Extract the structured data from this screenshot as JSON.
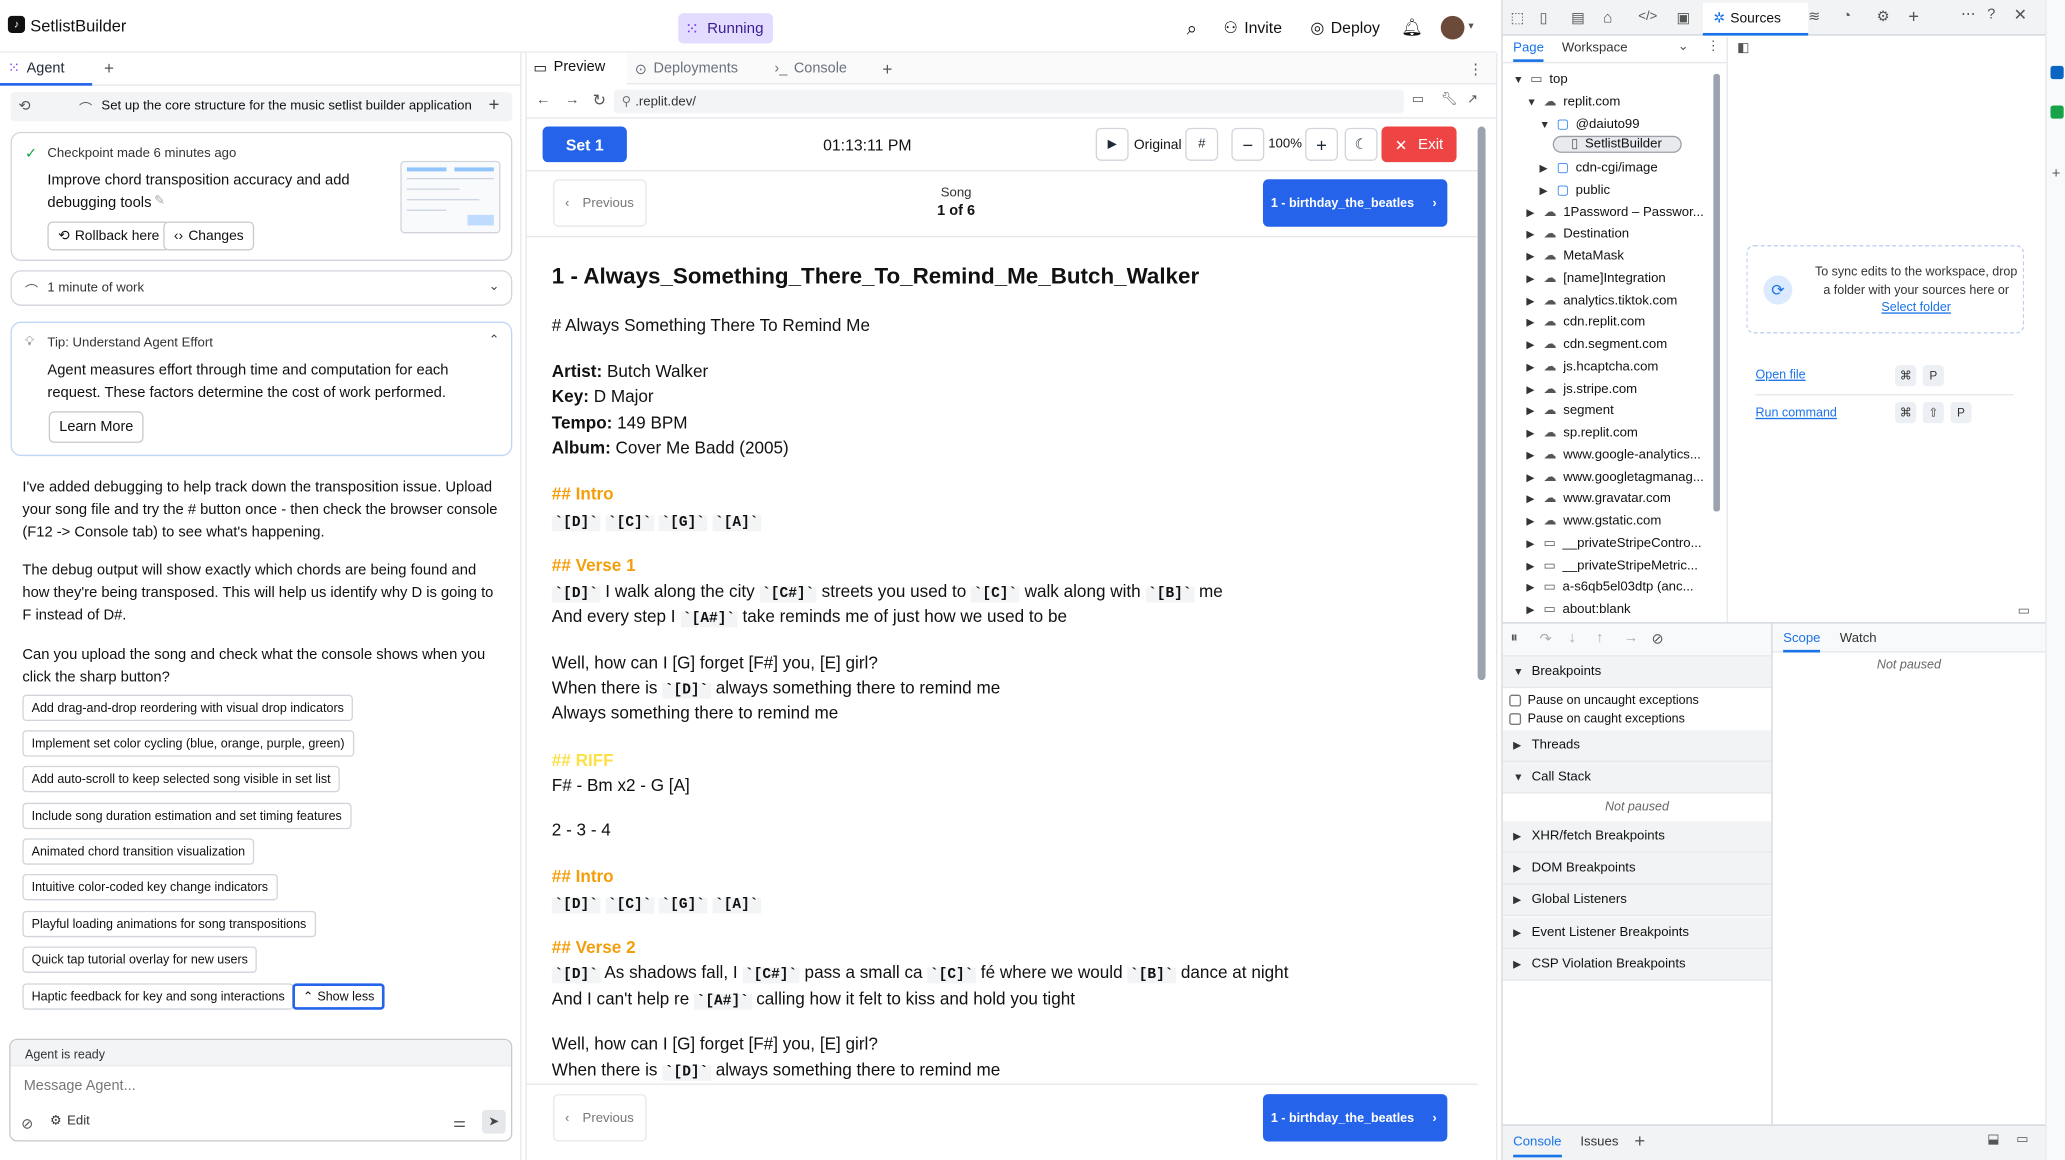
{
  "app": {
    "name": "SetlistBuilder",
    "status": "Running",
    "invite": "Invite",
    "deploy": "Deploy"
  },
  "left": {
    "tab": "Agent",
    "task_title": "Set up the core structure for the music setlist builder application",
    "checkpoint": {
      "title": "Checkpoint made 6 minutes ago",
      "desc": "Improve chord transposition accuracy and add debugging tools",
      "rollback": "Rollback here",
      "changes": "Changes"
    },
    "work": "1 minute of work",
    "tip": {
      "title": "Tip: Understand Agent Effort",
      "body": "Agent measures effort through time and computation for each request. These factors determine the cost of work performed.",
      "button": "Learn More"
    },
    "messages": [
      "I've added debugging to help track down the transposition issue. Upload your song file and try the # button once - then check the browser console (F12 -> Console tab) to see what's happening.",
      "The debug output will show exactly which chords are being found and how they're being transposed. This will help us identify why D is going to F instead of D#.",
      "Can you upload the song and check what the console shows when you click the sharp button?"
    ],
    "suggestions": [
      "Add drag-and-drop reordering with visual drop indicators",
      "Implement set color cycling (blue, orange, purple, green)",
      "Add auto-scroll to keep selected song visible in set list",
      "Include song duration estimation and set timing features",
      "Animated chord transition visualization",
      "Intuitive color-coded key change indicators",
      "Playful loading animations for song transpositions",
      "Quick tap tutorial overlay for new users",
      "Haptic feedback for key and song interactions"
    ],
    "show_less": "Show less",
    "status": "Agent is ready",
    "input_placeholder": "Message Agent...",
    "edit": "Edit"
  },
  "center": {
    "tabs": [
      "Preview",
      "Deployments",
      "Console"
    ],
    "url": ".replit.dev/",
    "set_label": "Set 1",
    "clock": "01:13:11 PM",
    "original": "Original",
    "sharp": "#",
    "zoom": "100%",
    "exit": "Exit",
    "previous": "Previous",
    "song_label": "Song",
    "song_index": "1 of 6",
    "next_song": "1 - birthday_the_beatles",
    "song_title": "1 - Always_Something_There_To_Remind_Me_Butch_Walker",
    "song_h1": "# Always Something There To Remind Me",
    "meta": {
      "artist_k": "Artist:",
      "artist_v": "Butch Walker",
      "key_k": "Key:",
      "key_v": "D Major",
      "tempo_k": "Tempo:",
      "tempo_v": "149 BPM",
      "album_k": "Album:",
      "album_v": "Cover Me Badd (2005)"
    },
    "intro_h": "## Intro",
    "intro_chords": [
      "`[D]`",
      "`[C]`",
      "`[G]`",
      "`[A]`"
    ],
    "verse1_h": "## Verse 1",
    "v1_l1": {
      "c1": "`[D]`",
      "t1": " I walk along the city ",
      "c2": "`[C#]`",
      "t2": " streets you used to ",
      "c3": "`[C]`",
      "t3": " walk along with ",
      "c4": "`[B]`",
      "t4": " me"
    },
    "v1_l2": {
      "t1": "And every step I ",
      "c1": "`[A#]`",
      "t2": " take reminds me of just how we used to be"
    },
    "chorus1": "Well, how can I [G] forget [F#] you, [E] girl?",
    "chorus2_a": "When there is ",
    "chorus2_c": "`[D]`",
    "chorus2_b": " always something there to remind me",
    "chorus3": "Always something there to remind me",
    "riff_h": "## RIFF",
    "riff_l1": "F# - Bm x2 - G [A]",
    "riff_l2": "2 - 3 - 4",
    "intro2_h": "## Intro",
    "verse2_h": "## Verse 2",
    "v2_l1": {
      "c1": "`[D]`",
      "t1": " As shadows fall, I ",
      "c2": "`[C#]`",
      "t2": " pass a small ca ",
      "c3": "`[C]`",
      "t3": " fé where we would ",
      "c4": "`[B]`",
      "t4": " dance at night"
    },
    "v2_l2": {
      "t1": "And I can't help re ",
      "c1": "`[A#]`",
      "t2": " calling how it felt to kiss and hold you tight"
    }
  },
  "devtools": {
    "active_tab": "Sources",
    "subtabs": [
      "Page",
      "Workspace"
    ],
    "tree": [
      {
        "label": "top",
        "depth": 0,
        "open": true,
        "kind": "frame"
      },
      {
        "label": "replit.com",
        "depth": 1,
        "open": true,
        "kind": "cloud"
      },
      {
        "label": "@daiuto99",
        "depth": 2,
        "open": true,
        "kind": "folder"
      },
      {
        "label": "SetlistBuilder",
        "depth": 3,
        "open": null,
        "kind": "file"
      },
      {
        "label": "cdn-cgi/image",
        "depth": 2,
        "open": false,
        "kind": "folder"
      },
      {
        "label": "public",
        "depth": 2,
        "open": false,
        "kind": "folder"
      },
      {
        "label": "1Password – Passwor...",
        "depth": 1,
        "open": false,
        "kind": "cloud"
      },
      {
        "label": "Destination",
        "depth": 1,
        "open": false,
        "kind": "cloud"
      },
      {
        "label": "MetaMask",
        "depth": 1,
        "open": false,
        "kind": "cloud"
      },
      {
        "label": "[name]Integration",
        "depth": 1,
        "open": false,
        "kind": "cloud"
      },
      {
        "label": "analytics.tiktok.com",
        "depth": 1,
        "open": false,
        "kind": "cloud"
      },
      {
        "label": "cdn.replit.com",
        "depth": 1,
        "open": false,
        "kind": "cloud"
      },
      {
        "label": "cdn.segment.com",
        "depth": 1,
        "open": false,
        "kind": "cloud"
      },
      {
        "label": "js.hcaptcha.com",
        "depth": 1,
        "open": false,
        "kind": "cloud"
      },
      {
        "label": "js.stripe.com",
        "depth": 1,
        "open": false,
        "kind": "cloud"
      },
      {
        "label": "segment",
        "depth": 1,
        "open": false,
        "kind": "cloud"
      },
      {
        "label": "sp.replit.com",
        "depth": 1,
        "open": false,
        "kind": "cloud"
      },
      {
        "label": "www.google-analytics...",
        "depth": 1,
        "open": false,
        "kind": "cloud"
      },
      {
        "label": "www.googletagmanag...",
        "depth": 1,
        "open": false,
        "kind": "cloud"
      },
      {
        "label": "www.gravatar.com",
        "depth": 1,
        "open": false,
        "kind": "cloud"
      },
      {
        "label": "www.gstatic.com",
        "depth": 1,
        "open": false,
        "kind": "cloud"
      },
      {
        "label": "__privateStripeContro...",
        "depth": 1,
        "open": false,
        "kind": "frame"
      },
      {
        "label": "__privateStripeMetric...",
        "depth": 1,
        "open": false,
        "kind": "frame"
      },
      {
        "label": "a-s6qb5el03dtp (anc...",
        "depth": 1,
        "open": false,
        "kind": "frame"
      },
      {
        "label": "about:blank",
        "depth": 1,
        "open": false,
        "kind": "frame"
      }
    ],
    "workspace_msg_a": "To sync edits to the workspace, drop a folder with your sources here or",
    "workspace_link": "Select folder",
    "open_file": "Open file",
    "run_command": "Run command",
    "kbd_open": [
      "⌘",
      "P"
    ],
    "kbd_run": [
      "⌘",
      "⇧",
      "P"
    ],
    "breakpoints": "Breakpoints",
    "pause_uncaught": "Pause on uncaught exceptions",
    "pause_caught": "Pause on caught exceptions",
    "threads": "Threads",
    "call_stack": "Call Stack",
    "not_paused": "Not paused",
    "sections": [
      "XHR/fetch Breakpoints",
      "DOM Breakpoints",
      "Global Listeners",
      "Event Listener Breakpoints",
      "CSP Violation Breakpoints"
    ],
    "scope": "Scope",
    "watch": "Watch",
    "scope_not_paused": "Not paused",
    "drawer_tabs": [
      "Console",
      "Issues"
    ]
  },
  "colors": {
    "accent": "#2563eb",
    "running": "#e0d7ff",
    "exit": "#ef4444",
    "orange": "#f59e0b",
    "riff": "#fde047"
  }
}
